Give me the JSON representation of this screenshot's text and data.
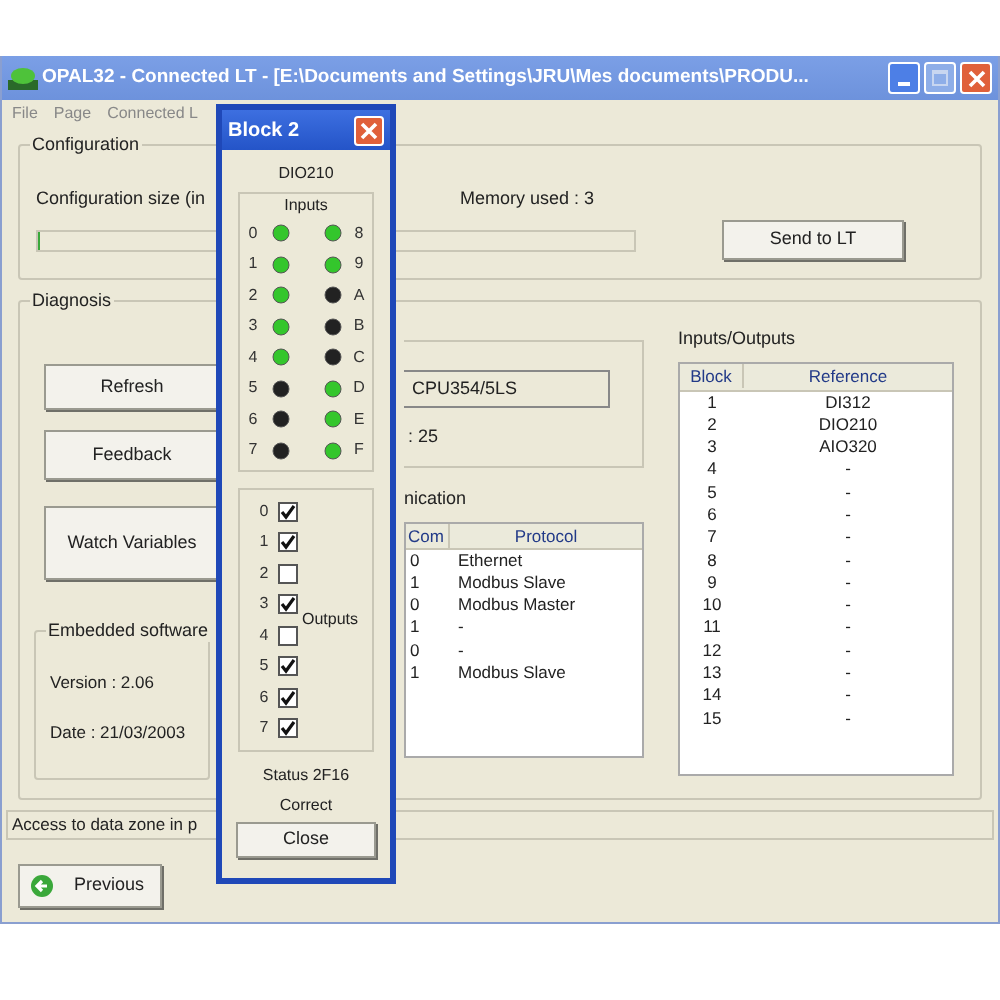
{
  "window": {
    "title": "OPAL32 - Connected LT - [E:\\Documents and Settings\\JRU\\Mes documents\\PRODU..."
  },
  "menu": [
    "File",
    "Page",
    "Connected L"
  ],
  "configuration": {
    "title": "Configuration",
    "size_label": "Configuration size (in",
    "progress": {
      "level": 0
    },
    "memory_used": "Memory used : 3",
    "send_button": "Send to LT"
  },
  "diagnosis": {
    "title": "Diagnosis",
    "buttons": [
      "Refresh",
      "Feedback",
      "Watch Variables"
    ],
    "cpu_field": "CPU354/5LS",
    "count": ": 25",
    "embedded": {
      "title": "Embedded software",
      "version": "Version : 2.06",
      "date": "Date : 21/03/2003"
    },
    "communication": {
      "title": "nication",
      "columns": [
        "Com",
        "Protocol"
      ],
      "rows": [
        [
          "0",
          "Ethernet"
        ],
        [
          "1",
          "Modbus Slave"
        ],
        [
          "0",
          "Modbus Master"
        ],
        [
          "1",
          "-"
        ],
        [
          "0",
          "-"
        ],
        [
          "1",
          "Modbus Slave"
        ]
      ]
    },
    "io": {
      "title": "Inputs/Outputs",
      "columns": [
        "Block",
        "Reference"
      ],
      "rows": [
        [
          "1",
          "DI312"
        ],
        [
          "2",
          "DIO210"
        ],
        [
          "3",
          "AIO320"
        ],
        [
          "4",
          "-"
        ],
        [
          "5",
          "-"
        ],
        [
          "6",
          "-"
        ],
        [
          "7",
          "-"
        ],
        [
          "8",
          "-"
        ],
        [
          "9",
          "-"
        ],
        [
          "10",
          "-"
        ],
        [
          "11",
          "-"
        ],
        [
          "12",
          "-"
        ],
        [
          "13",
          "-"
        ],
        [
          "14",
          "-"
        ],
        [
          "15",
          "-"
        ]
      ]
    }
  },
  "status_field": "Access to data zone in p",
  "previous_button": "Previous",
  "dialog": {
    "title": "Block 2",
    "module": "DIO210",
    "inputs_title": "Inputs",
    "inputs": [
      {
        "label": "0",
        "on": true
      },
      {
        "label": "1",
        "on": true
      },
      {
        "label": "2",
        "on": true
      },
      {
        "label": "3",
        "on": true
      },
      {
        "label": "4",
        "on": true
      },
      {
        "label": "5",
        "on": false
      },
      {
        "label": "6",
        "on": false
      },
      {
        "label": "7",
        "on": false
      },
      {
        "label": "8",
        "on": true
      },
      {
        "label": "9",
        "on": true
      },
      {
        "label": "A",
        "on": false
      },
      {
        "label": "B",
        "on": false
      },
      {
        "label": "C",
        "on": false
      },
      {
        "label": "D",
        "on": true
      },
      {
        "label": "E",
        "on": true
      },
      {
        "label": "F",
        "on": true
      }
    ],
    "outputs_title": "Outputs",
    "outputs": [
      {
        "label": "0",
        "checked": true
      },
      {
        "label": "1",
        "checked": true
      },
      {
        "label": "2",
        "checked": false
      },
      {
        "label": "3",
        "checked": true
      },
      {
        "label": "4",
        "checked": false
      },
      {
        "label": "5",
        "checked": true
      },
      {
        "label": "6",
        "checked": true
      },
      {
        "label": "7",
        "checked": true
      }
    ],
    "status": "Status 2F16",
    "result": "Correct",
    "close_button": "Close"
  }
}
